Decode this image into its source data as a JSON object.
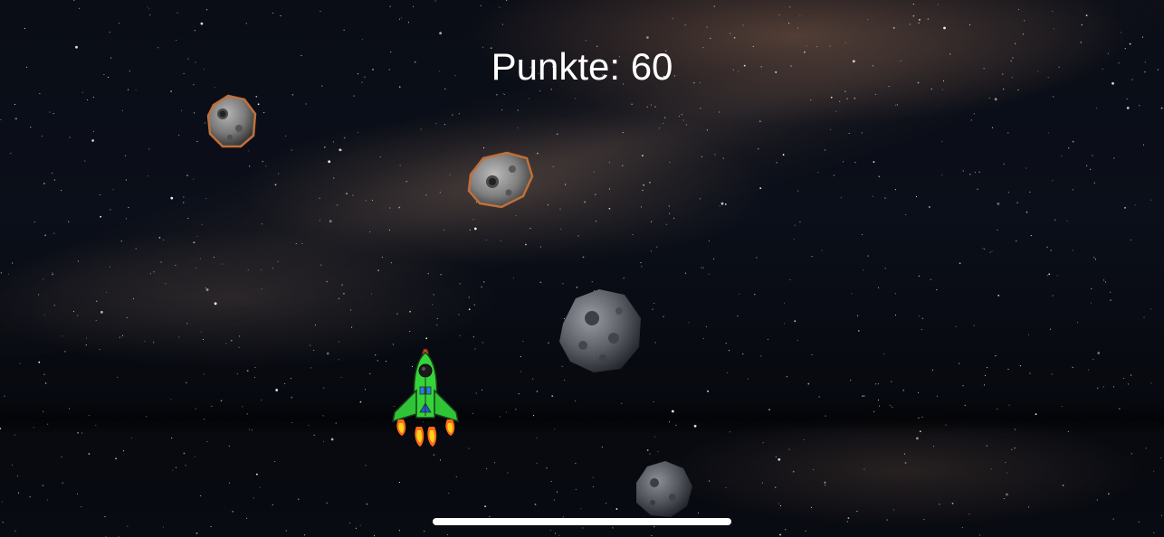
{
  "hud": {
    "score_label": "Punkte: 60"
  },
  "asteroids": [
    {
      "name": "asteroid-1",
      "color": "#8a8a8a",
      "glow": "#c0703a"
    },
    {
      "name": "asteroid-2",
      "color": "#8e8e8e",
      "glow": "#c0703a"
    },
    {
      "name": "asteroid-3",
      "color": "#6e7078",
      "glow": ""
    },
    {
      "name": "asteroid-4",
      "color": "#5e6068",
      "glow": ""
    }
  ],
  "player": {
    "icon": "spaceship-icon",
    "body_color": "#35d43a",
    "cockpit_color": "#1a1a1a",
    "flame_color": "#ff6a1a"
  },
  "colors": {
    "background": "#05070c",
    "score_text": "#ffffff",
    "home_indicator": "#ffffff"
  }
}
